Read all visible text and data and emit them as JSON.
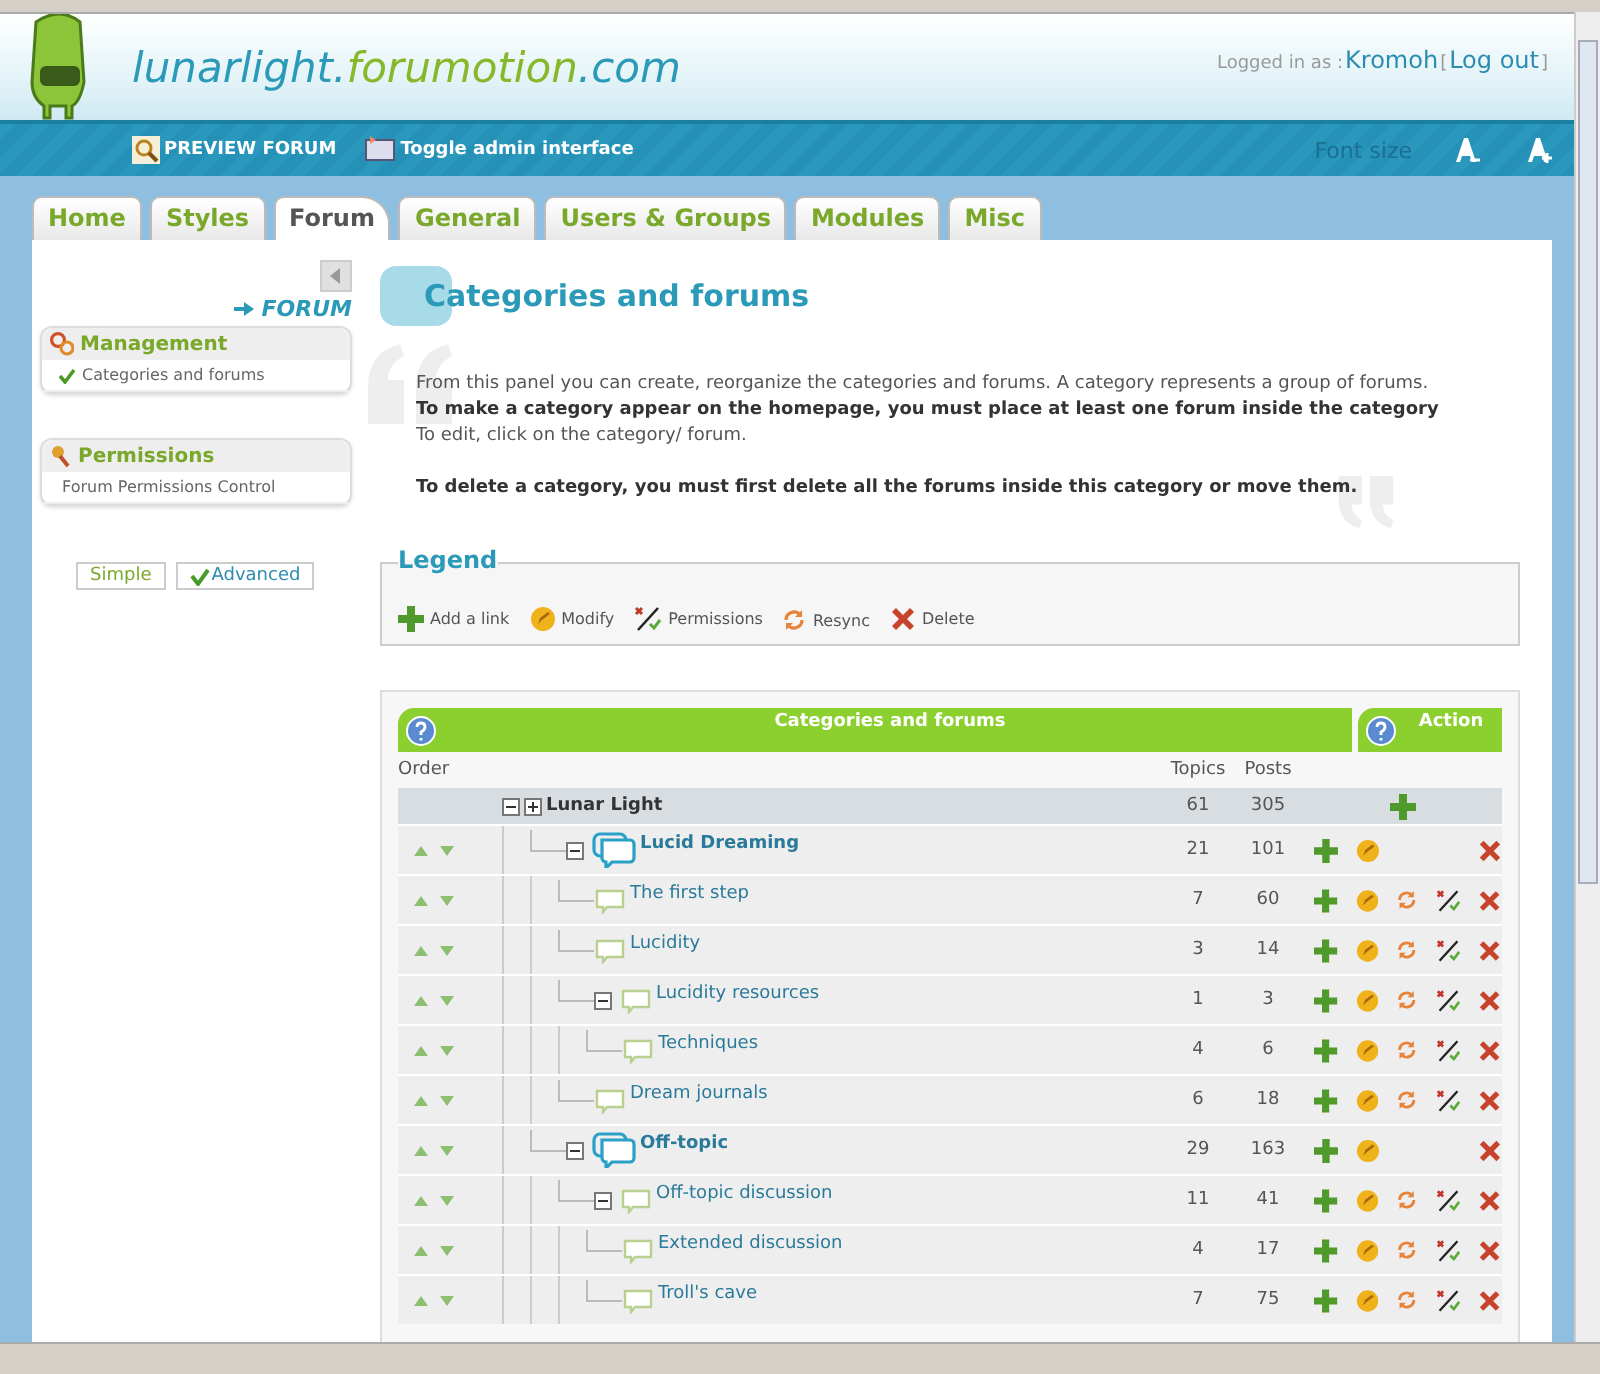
{
  "header": {
    "title_parts": [
      {
        "text": "lunarlight.",
        "color": "#2a9ab8"
      },
      {
        "text": "forumotion",
        "color": "#86b82a"
      },
      {
        "text": ".com",
        "color": "#2a9ab8"
      }
    ],
    "logged_in_label": "Logged in as :",
    "user": "Kromoh",
    "bracket_open": "[",
    "logout": "Log out",
    "bracket_close": "]"
  },
  "admin_bar": {
    "links": [
      {
        "label": "PREVIEW FORUM",
        "kind": "preview"
      },
      {
        "label": "Toggle admin interface",
        "kind": "toggle"
      }
    ],
    "font_size_label": "Font size"
  },
  "tabs": [
    {
      "label": "Home",
      "selected": false
    },
    {
      "label": "Styles",
      "selected": false
    },
    {
      "label": "Forum",
      "selected": true
    },
    {
      "label": "General",
      "selected": false
    },
    {
      "label": "Users & Groups",
      "selected": false
    },
    {
      "label": "Modules",
      "selected": false
    },
    {
      "label": "Misc",
      "selected": false
    }
  ],
  "sidebar": {
    "heading": "FORUM",
    "sections": [
      {
        "title": "Management",
        "kind": "management",
        "items": [
          {
            "label": "Categories and forums",
            "selected": true
          }
        ]
      },
      {
        "title": "Permissions",
        "kind": "permissions",
        "items": [
          {
            "label": "Forum Permissions Control",
            "selected": false
          }
        ]
      }
    ],
    "modes": [
      {
        "label": "Simple",
        "selected": false
      },
      {
        "label": "Advanced",
        "selected": true
      }
    ]
  },
  "page": {
    "title": "Categories and forums",
    "paragraphs": [
      {
        "text": "From this panel you can create, reorganize the categories and forums. A category represents a group of forums.",
        "bold": false
      },
      {
        "text": "To make a category appear on the homepage, you must place at least one forum inside the category",
        "bold": true
      },
      {
        "text": "To edit, click on the category/ forum.",
        "bold": false
      },
      {
        "text": "To delete a category, you must first delete all the forums inside this category or move them.",
        "bold": true
      }
    ]
  },
  "legend": {
    "title": "Legend",
    "items": [
      {
        "label": "Add a link",
        "kind": "add"
      },
      {
        "label": "Modify",
        "kind": "modify"
      },
      {
        "label": "Permissions",
        "kind": "permissions"
      },
      {
        "label": "Resync",
        "kind": "resync"
      },
      {
        "label": "Delete",
        "kind": "delete"
      }
    ]
  },
  "table": {
    "header": "Categories and forums",
    "action_header": "Action",
    "columns": [
      "Order",
      "Topics",
      "Posts"
    ],
    "category": {
      "name": "Lunar Light",
      "topics": "61",
      "posts": "305",
      "expanded": true
    },
    "forums": [
      {
        "name": "Lucid Dreaming",
        "kind": "main",
        "topics": "21",
        "posts": "101",
        "expanded": true,
        "children": [
          {
            "name": "The first step",
            "kind": "sub",
            "topics": "7",
            "posts": "60"
          },
          {
            "name": "Lucidity",
            "kind": "sub",
            "topics": "3",
            "posts": "14"
          },
          {
            "name": "Lucidity resources",
            "kind": "sub",
            "topics": "1",
            "posts": "3",
            "expanded": true,
            "children": [
              {
                "name": "Techniques",
                "kind": "sub",
                "topics": "4",
                "posts": "6"
              }
            ]
          },
          {
            "name": "Dream journals",
            "kind": "sub",
            "topics": "6",
            "posts": "18"
          }
        ]
      },
      {
        "name": "Off-topic",
        "kind": "main",
        "topics": "29",
        "posts": "163",
        "expanded": true,
        "children": [
          {
            "name": "Off-topic discussion",
            "kind": "sub",
            "topics": "11",
            "posts": "41",
            "expanded": true,
            "children": [
              {
                "name": "Extended discussion",
                "kind": "sub",
                "topics": "4",
                "posts": "17"
              },
              {
                "name": "Troll's cave",
                "kind": "sub",
                "topics": "7",
                "posts": "75"
              }
            ]
          }
        ]
      }
    ]
  }
}
